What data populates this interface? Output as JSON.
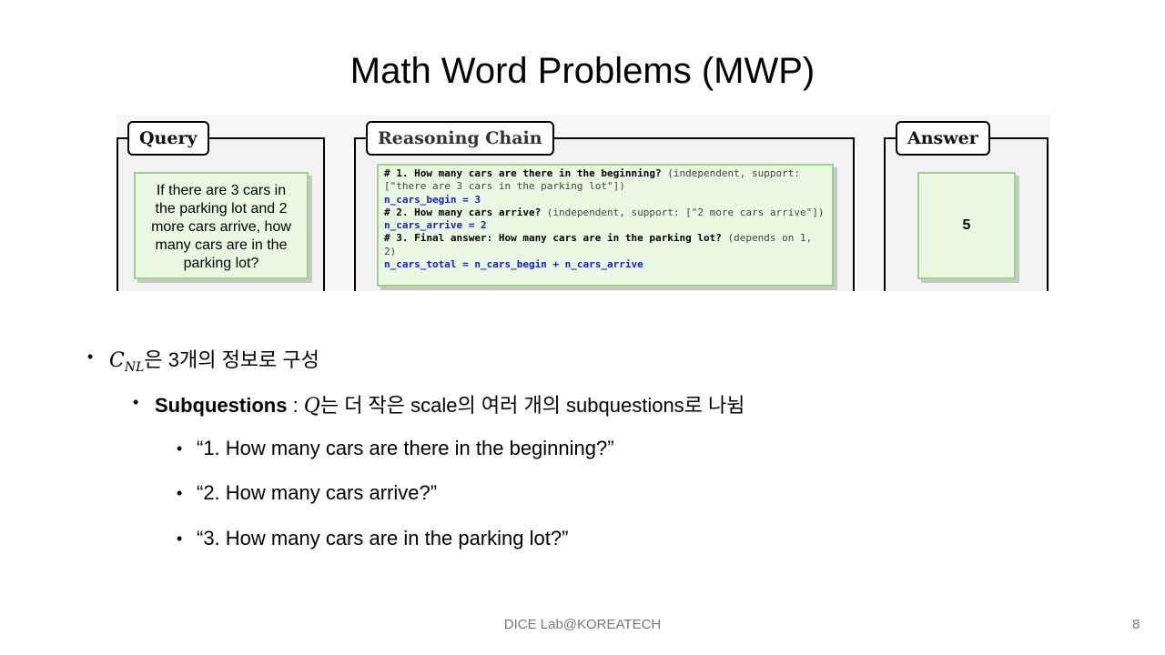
{
  "slide": {
    "title": "Math Word Problems (MWP)",
    "footer": "DICE Lab@KOREATECH",
    "page_number": "8"
  },
  "figure": {
    "query": {
      "label": "Query",
      "text": "If there are 3 cars in the parking lot and 2 more cars arrive, how many cars are in the parking lot?"
    },
    "reasoning": {
      "label": "Reasoning Chain",
      "lines": [
        {
          "q": "# 1. How many cars are there in the beginning?",
          "rest": " (independent, support: [\"there are 3 cars in the parking lot\"])"
        },
        {
          "code": "n_cars_begin = 3"
        },
        {
          "q": "# 2. How many cars arrive?",
          "rest": " (independent, support: [\"2 more cars arrive\"])"
        },
        {
          "code": "n_cars_arrive = 2"
        },
        {
          "q": "# 3. Final answer: How many cars are in the parking lot?",
          "rest": " (depends on 1, 2)"
        },
        {
          "code": "n_cars_total = n_cars_begin + n_cars_arrive"
        }
      ]
    },
    "answer": {
      "label": "Answer",
      "value": "5"
    }
  },
  "bullets": {
    "b1": {
      "math_main": "C",
      "math_sub": "NL",
      "text": "은 3개의 정보로 구성"
    },
    "b2": {
      "bold": "Subquestions",
      "sep": " : ",
      "math": "Q",
      "text": "는 더 작은 scale의 여러 개의 subquestions로 나뉨"
    },
    "sub": [
      "“1. How many cars are there in the beginning?”",
      "“2. How many cars arrive?”",
      "“3. How many cars are in the parking lot?”"
    ]
  }
}
